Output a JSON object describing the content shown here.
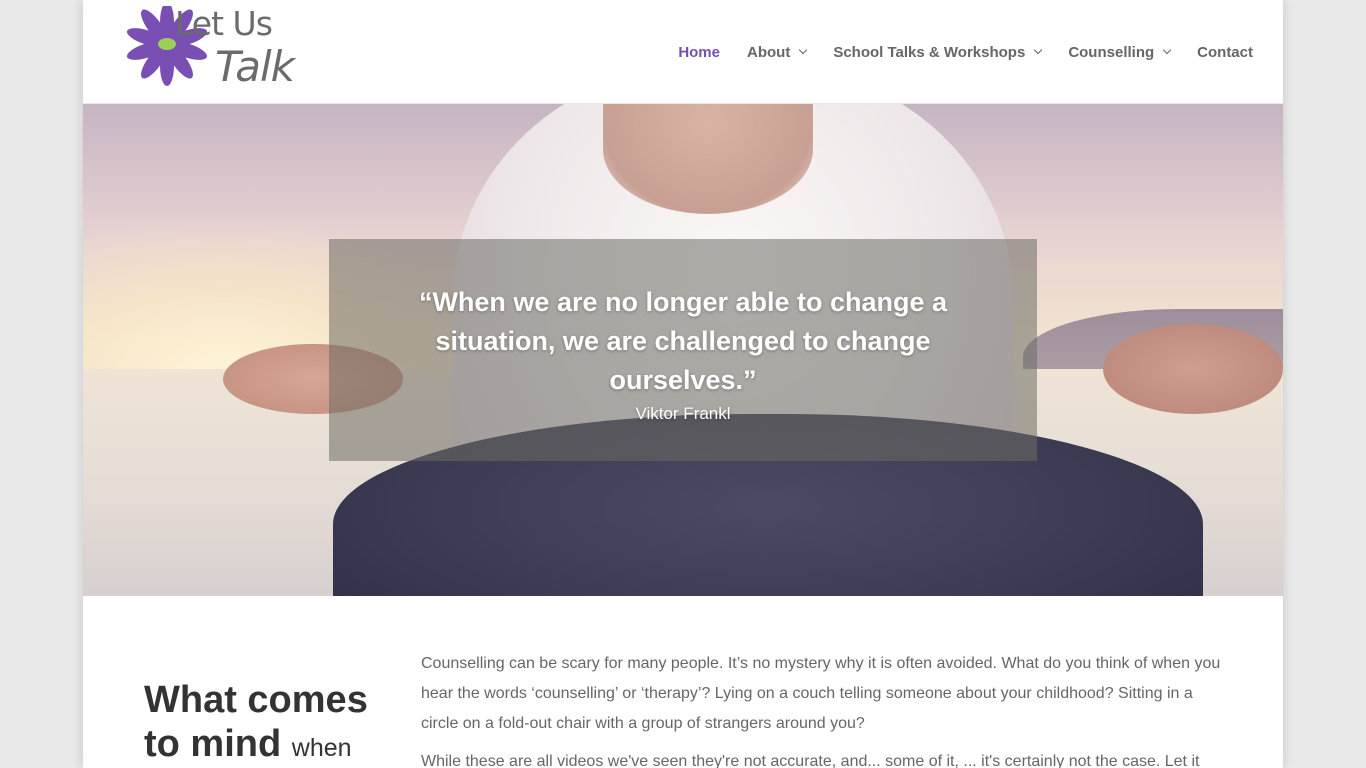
{
  "brand": {
    "logo_line1": "Let Us",
    "logo_line2": "Talk",
    "flower_color": "#7a4fb4",
    "center_color": "#9ccf5a"
  },
  "nav": {
    "items": [
      {
        "label": "Home",
        "active": true,
        "has_dropdown": false
      },
      {
        "label": "About",
        "active": false,
        "has_dropdown": true
      },
      {
        "label": "School Talks & Workshops",
        "active": false,
        "has_dropdown": true
      },
      {
        "label": "Counselling",
        "active": false,
        "has_dropdown": true
      },
      {
        "label": "Contact",
        "active": false,
        "has_dropdown": false
      }
    ],
    "active_color": "#7650a8"
  },
  "hero": {
    "quote": "“When we are no longer able to change a situation, we are challenged to change ourselves.”",
    "author": "Viktor Frankl"
  },
  "content": {
    "heading_main": "What comes to mind",
    "heading_tail": "when",
    "paragraphs": [
      "Counselling can be scary for many people. It’s no mystery why it is often avoided. What do you think of when you hear the words ‘counselling’ or ‘therapy’? Lying on a couch telling someone about your childhood? Sitting in a circle on a fold-out chair with a group of strangers around you?",
      "While these are all videos we've seen they're not accurate, and... some of it, ... it's certainly not the case. Let it"
    ]
  }
}
